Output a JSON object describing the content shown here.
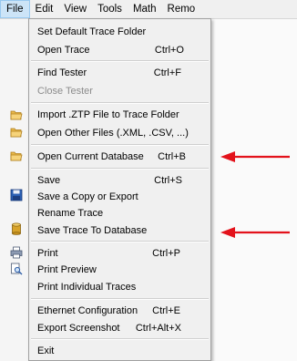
{
  "menubar": {
    "items": [
      "File",
      "Edit",
      "View",
      "Tools",
      "Math",
      "Remo"
    ]
  },
  "file_menu": {
    "set_default_trace_folder": "Set Default Trace Folder",
    "open_trace": "Open Trace",
    "open_trace_shortcut": "Ctrl+O",
    "find_tester": "Find Tester",
    "find_tester_shortcut": "Ctrl+F",
    "close_tester": "Close Tester",
    "import_ztp": "Import .ZTP File to Trace Folder",
    "open_other_files": "Open Other Files (.XML, .CSV, ...)",
    "open_current_database": "Open Current Database",
    "open_current_database_shortcut": "Ctrl+B",
    "save": "Save",
    "save_shortcut": "Ctrl+S",
    "save_copy_or_export": "Save a Copy or Export",
    "rename_trace": "Rename Trace",
    "save_trace_to_database": "Save Trace To Database",
    "print": "Print",
    "print_shortcut": "Ctrl+P",
    "print_preview": "Print Preview",
    "print_individual_traces": "Print Individual Traces",
    "ethernet_configuration": "Ethernet Configuration",
    "ethernet_configuration_shortcut": "Ctrl+E",
    "export_screenshot": "Export Screenshot",
    "export_screenshot_shortcut": "Ctrl+Alt+X",
    "exit": "Exit"
  },
  "colors": {
    "arrow": "#e3121b",
    "menu_background": "#f0f0f0",
    "menubar_active": "#cce4f7"
  },
  "icons": [
    "folder-icon",
    "floppy-disk-icon",
    "database-icon",
    "printer-icon",
    "print-preview-icon"
  ]
}
